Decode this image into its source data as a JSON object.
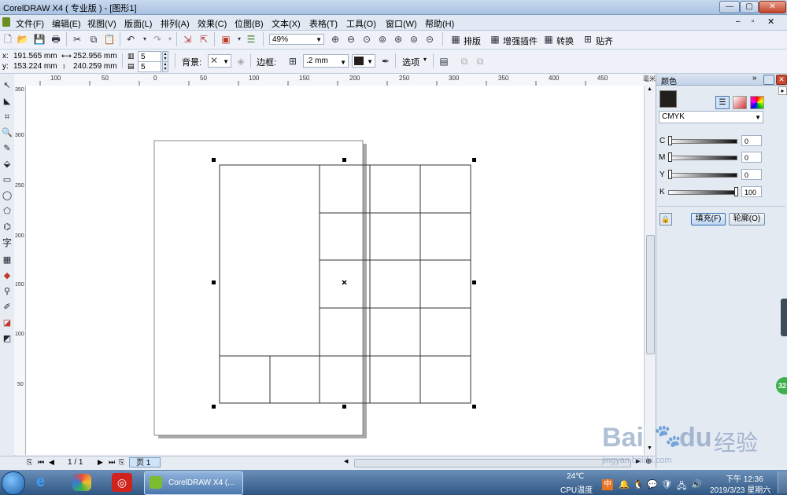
{
  "window": {
    "title": "CorelDRAW X4 ( 专业版 ) - [图形1]",
    "min_glyph": "—",
    "max_glyph": "▢",
    "close_glyph": "✕"
  },
  "menu": [
    "文件(F)",
    "编辑(E)",
    "视图(V)",
    "版面(L)",
    "排列(A)",
    "效果(C)",
    "位图(B)",
    "文本(X)",
    "表格(T)",
    "工具(O)",
    "窗口(W)",
    "帮助(H)"
  ],
  "toolbar": {
    "zoom": "49%",
    "buttons": [
      "排版",
      "增强插件",
      "转换",
      "贴齐"
    ]
  },
  "propbar": {
    "x": "191.565 mm",
    "y": "153.224 mm",
    "width": "252.956 mm",
    "height": "240.259 mm",
    "x_label": "x:",
    "y_label": "y:",
    "cols": "5",
    "rows": "5",
    "bg_label": "背景:",
    "border_label": "边框:",
    "border_width": ".2 mm",
    "options_label": "选项"
  },
  "ruler_top": [
    "100",
    "50",
    "0",
    "50",
    "100",
    "150",
    "200",
    "250",
    "300",
    "350",
    "400",
    "450"
  ],
  "ruler_left": [
    "350",
    "300",
    "250",
    "200",
    "150",
    "100",
    "50"
  ],
  "ruler_unit": "毫米",
  "docker": {
    "title": "颜色",
    "model": "CMYK",
    "channels": [
      {
        "label": "C",
        "value": "0"
      },
      {
        "label": "M",
        "value": "0"
      },
      {
        "label": "Y",
        "value": "0"
      },
      {
        "label": "K",
        "value": "100"
      }
    ],
    "fill_button": "填充(F)",
    "outline_button": "轮廓(O)"
  },
  "statusbar": {
    "page_counter": "1 / 1",
    "page_tab": "页 1"
  },
  "taskbar": {
    "active_app": "CorelDRAW X4 (...",
    "temperature": "24℃",
    "temp_label": "CPU温度",
    "ime": "中",
    "time": "下午 12:36",
    "date": "2019/3/23 星期六",
    "badge": "32"
  },
  "watermark": {
    "brand": "Bai",
    "brand2": "du",
    "cn": "经验",
    "url": "jingyan.baidu.com"
  },
  "colors": {
    "accent": "#1f4f8a",
    "selected_fill": "#231f1c"
  }
}
